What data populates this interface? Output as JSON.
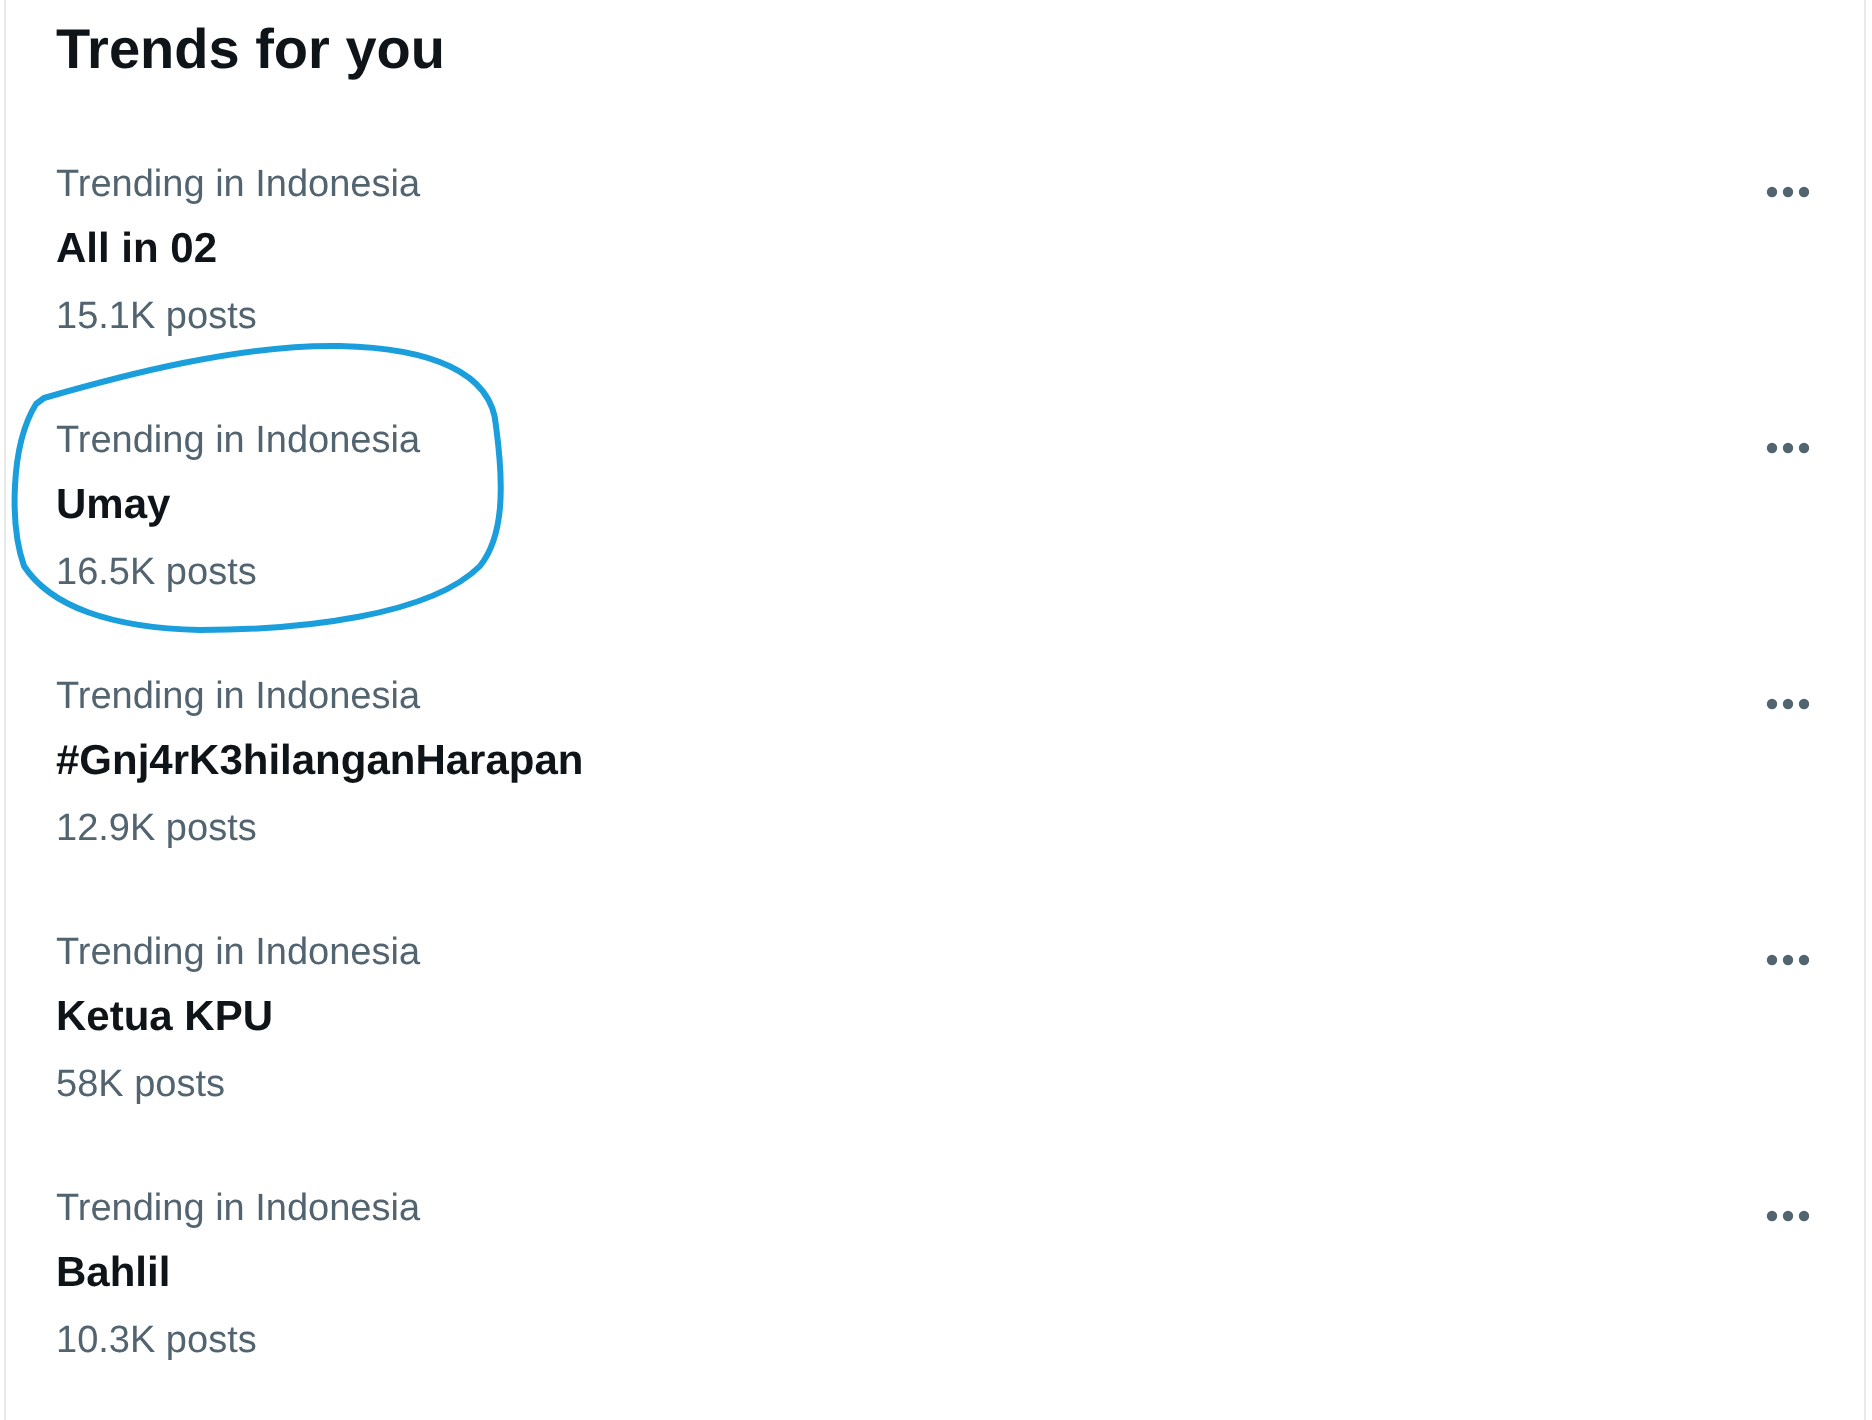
{
  "title": "Trends for you",
  "trends": [
    {
      "category": "Trending in Indonesia",
      "name": "All in 02",
      "posts": "15.1K posts",
      "circled": false
    },
    {
      "category": "Trending in Indonesia",
      "name": "Umay",
      "posts": "16.5K posts",
      "circled": true
    },
    {
      "category": "Trending in Indonesia",
      "name": "#Gnj4rK3hilanganHarapan",
      "posts": "12.9K posts",
      "circled": false
    },
    {
      "category": "Trending in Indonesia",
      "name": "Ketua KPU",
      "posts": "58K posts",
      "circled": false
    },
    {
      "category": "Trending in Indonesia",
      "name": "Bahlil",
      "posts": "10.3K posts",
      "circled": false
    }
  ]
}
